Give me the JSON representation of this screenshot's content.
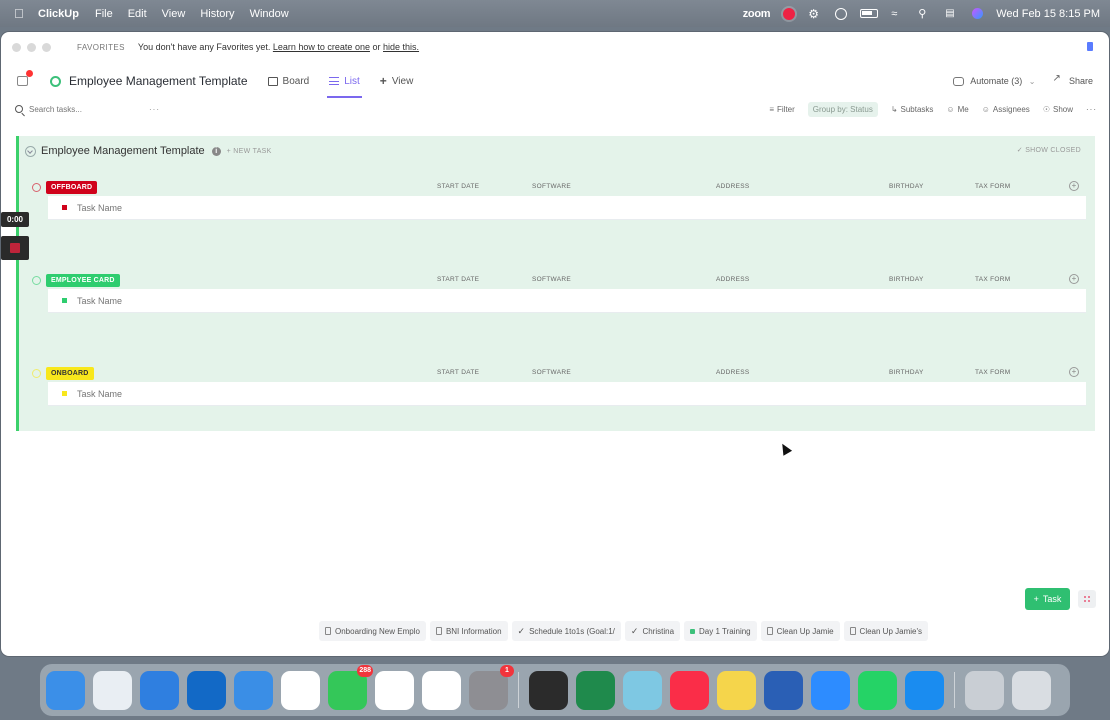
{
  "menubar": {
    "app_name": "ClickUp",
    "menus": [
      "File",
      "Edit",
      "View",
      "History",
      "Window"
    ],
    "zoom_label": "zoom",
    "datetime": "Wed Feb 15  8:15 PM"
  },
  "favorites": {
    "label": "FAVORITES",
    "text": "You don't have any Favorites yet.",
    "link_create": "Learn how to create one",
    "or_text": "or",
    "link_hide": "hide this."
  },
  "viewbar": {
    "title": "Employee Management Template",
    "tab_board": "Board",
    "tab_list": "List",
    "tab_view": "View",
    "automate": "Automate",
    "automate_count": "(3)",
    "share": "Share"
  },
  "filterbar": {
    "search_placeholder": "Search tasks...",
    "filter": "Filter",
    "group_by": "Group by: Status",
    "subtasks": "Subtasks",
    "me": "Me",
    "assignees": "Assignees",
    "show": "Show"
  },
  "list": {
    "name": "Employee Management Template",
    "new_task": "+ NEW TASK",
    "show_closed": "SHOW CLOSED",
    "columns": [
      "START DATE",
      "SOFTWARE",
      "ADDRESS",
      "BIRTHDAY",
      "TAX FORM"
    ],
    "groups": [
      {
        "status": "OFFBOARD",
        "color": "#d0021b",
        "task_placeholder": "Task Name"
      },
      {
        "status": "EMPLOYEE CARD",
        "color": "#2ecd6f",
        "task_placeholder": "Task Name"
      },
      {
        "status": "ONBOARD",
        "color": "#f8e71c",
        "task_placeholder": "Task Name"
      }
    ]
  },
  "timer": "0:00",
  "tray": {
    "items": [
      "Onboarding New Emplo",
      "BNI Information",
      "Schedule 1to1s (Goal:1/",
      "Christina",
      "Day 1 Training",
      "Clean Up Jamie",
      "Clean Up Jamie's"
    ],
    "add_task": "Task"
  },
  "dock": {
    "apps": [
      {
        "icon": "finder-icon",
        "color": "#3b8fe8",
        "badge": ""
      },
      {
        "icon": "chrome-icon",
        "color": "#e9eef3",
        "badge": ""
      },
      {
        "icon": "safari-icon",
        "color": "#2f7fe0",
        "badge": ""
      },
      {
        "icon": "outlook-icon",
        "color": "#1269c6",
        "badge": ""
      },
      {
        "icon": "dropbox-icon",
        "color": "#3a8ee6",
        "badge": ""
      },
      {
        "icon": "clickup-icon",
        "color": "#ffffff",
        "badge": ""
      },
      {
        "icon": "messages-icon",
        "color": "#34c759",
        "badge": "288"
      },
      {
        "icon": "slack-icon",
        "color": "#ffffff",
        "badge": ""
      },
      {
        "icon": "asana-icon",
        "color": "#ffffff",
        "badge": ""
      },
      {
        "icon": "settings-icon",
        "color": "#8e8e93",
        "badge": "1"
      },
      {
        "icon": "terminal-icon",
        "color": "#2b2b2b",
        "badge": ""
      },
      {
        "icon": "excel-icon",
        "color": "#1f8a4c",
        "badge": ""
      },
      {
        "icon": "maps-icon",
        "color": "#7ec8e3",
        "badge": ""
      },
      {
        "icon": "music-icon",
        "color": "#fa2d48",
        "badge": ""
      },
      {
        "icon": "notes-icon",
        "color": "#f5d54b",
        "badge": ""
      },
      {
        "icon": "word-icon",
        "color": "#2a5fb5",
        "badge": ""
      },
      {
        "icon": "zoom-icon",
        "color": "#2d8cff",
        "badge": ""
      },
      {
        "icon": "whatsapp-icon",
        "color": "#25d366",
        "badge": ""
      },
      {
        "icon": "appstore-icon",
        "color": "#1a8cf0",
        "badge": ""
      },
      {
        "icon": "downloads-icon",
        "color": "#c9ced4",
        "badge": ""
      },
      {
        "icon": "trash-icon",
        "color": "#d9dde2",
        "badge": ""
      }
    ]
  }
}
